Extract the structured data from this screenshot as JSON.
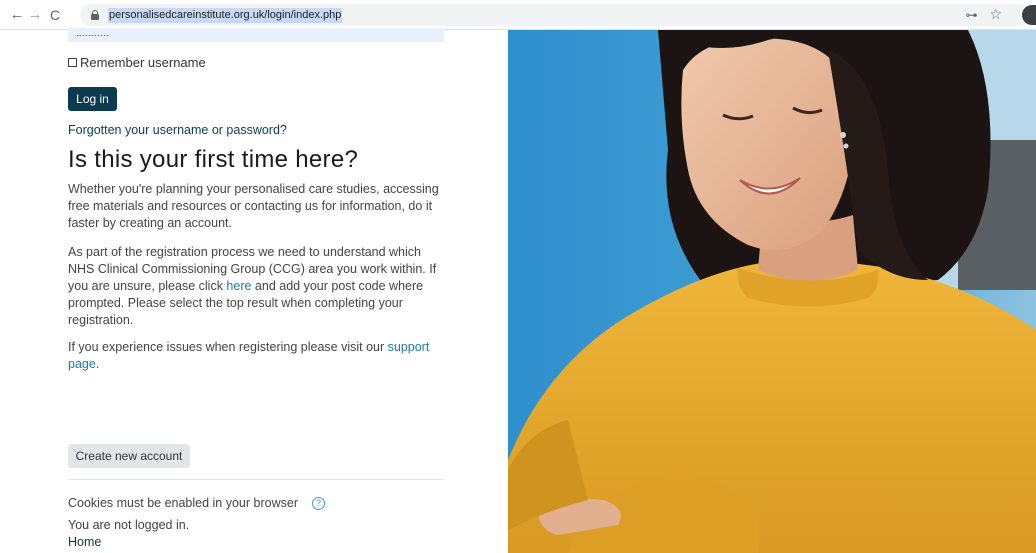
{
  "browser": {
    "back_icon": "←",
    "forward_icon": "→",
    "reload_icon": "C",
    "url": "personalisedcareinstitute.org.uk/login/index.php",
    "key_icon": "🔑",
    "star_icon": "☆"
  },
  "login": {
    "password_mask": "...........",
    "remember_label": "Remember username",
    "login_button": "Log in",
    "forgot_link": "Forgotten your username or password?"
  },
  "first_time": {
    "heading": "Is this your first time here?",
    "para1": "Whether you're planning your personalised care studies, accessing free materials and resources or contacting us for information, do it faster by creating an account.",
    "para2_before": "As part of the registration process we need to understand which NHS Clinical Commissioning Group (CCG) area you work within. If you are unsure, please click ",
    "para2_link": "here",
    "para2_after": " and add your post code where prompted. Please select the top result when completing your registration.",
    "para3_before": "If you experience issues when registering please visit our ",
    "para3_link": "support page",
    "para3_after": ".",
    "create_button": "Create new account"
  },
  "footer": {
    "cookies": "Cookies must be enabled in your browser",
    "help_icon": "?",
    "not_logged_in": "You are not logged in.",
    "home_link": "Home"
  },
  "colors": {
    "primary_button": "#0c3b4f",
    "link": "#1d7ba3",
    "photo_background": "#3f9fd3",
    "sweater": "#e4a92c"
  }
}
